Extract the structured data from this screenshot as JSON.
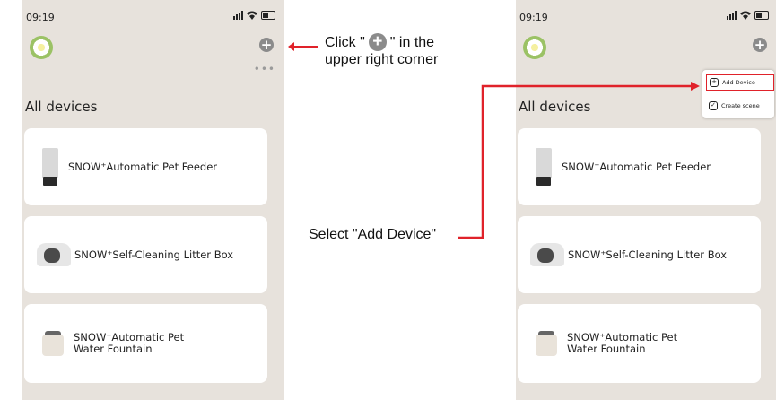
{
  "phones": [
    {
      "status": {
        "time": "09:19"
      },
      "section_title": "All devices",
      "more": "•••",
      "devices": [
        {
          "name": "SNOW⁺Automatic Pet Feeder",
          "icon": "feeder-image"
        },
        {
          "name": "SNOW⁺Self-Cleaning Litter Box",
          "icon": "litter-box-image"
        },
        {
          "name": "SNOW⁺Automatic Pet\nWater Fountain",
          "icon": "fountain-image"
        }
      ]
    },
    {
      "status": {
        "time": "09:19"
      },
      "section_title": "All devices",
      "devices": [
        {
          "name": "SNOW⁺Automatic Pet Feeder",
          "icon": "feeder-image"
        },
        {
          "name": "SNOW⁺Self-Cleaning Litter Box",
          "icon": "litter-box-image"
        },
        {
          "name": "SNOW⁺Automatic Pet\nWater Fountain",
          "icon": "fountain-image"
        }
      ],
      "menu": {
        "add_device": "Add Device",
        "create_scene": "Create scene"
      }
    }
  ],
  "annotations": {
    "click_prefix": "Click \"",
    "click_suffix": "\" in the",
    "click_line2": "upper right corner",
    "select": "Select \"Add Device\""
  },
  "colors": {
    "accent": "#e0222a",
    "background": "#e7e2dc",
    "card": "#ffffff"
  }
}
